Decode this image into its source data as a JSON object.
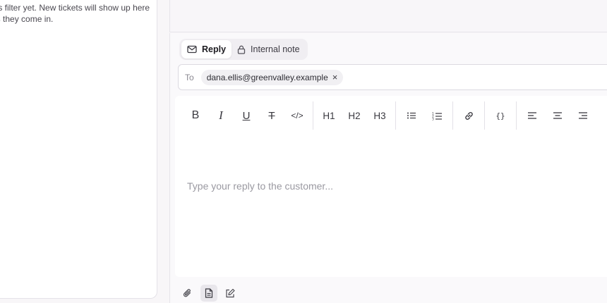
{
  "ticket_list": {
    "empty_message": "his filter yet. New tickets will show up here as they come in."
  },
  "composer": {
    "tabs": [
      {
        "label": "Reply",
        "icon": "mail-icon",
        "active": true
      },
      {
        "label": "Internal note",
        "icon": "lock-icon",
        "active": false
      }
    ],
    "to_label": "To",
    "recipients": [
      {
        "email": "dana.ellis@greenvalley.example"
      }
    ],
    "remove_glyph": "×",
    "toolbar": {
      "bold": "B",
      "italic": "I",
      "underline": "U",
      "strike": "T",
      "code": "</>",
      "h1": "H1",
      "h2": "H2",
      "h3": "H3",
      "code_block": "{}"
    },
    "placeholder": "Type your reply to the customer...",
    "bottom_actions": [
      {
        "icon": "paperclip-icon"
      },
      {
        "icon": "document-icon",
        "active": true
      },
      {
        "icon": "edit-icon"
      }
    ]
  },
  "colors": {
    "background": "#f8f6f8",
    "panel": "#ffffff",
    "border": "#dcdae1",
    "muted_text": "#8a8891",
    "placeholder": "#9a99a1"
  }
}
